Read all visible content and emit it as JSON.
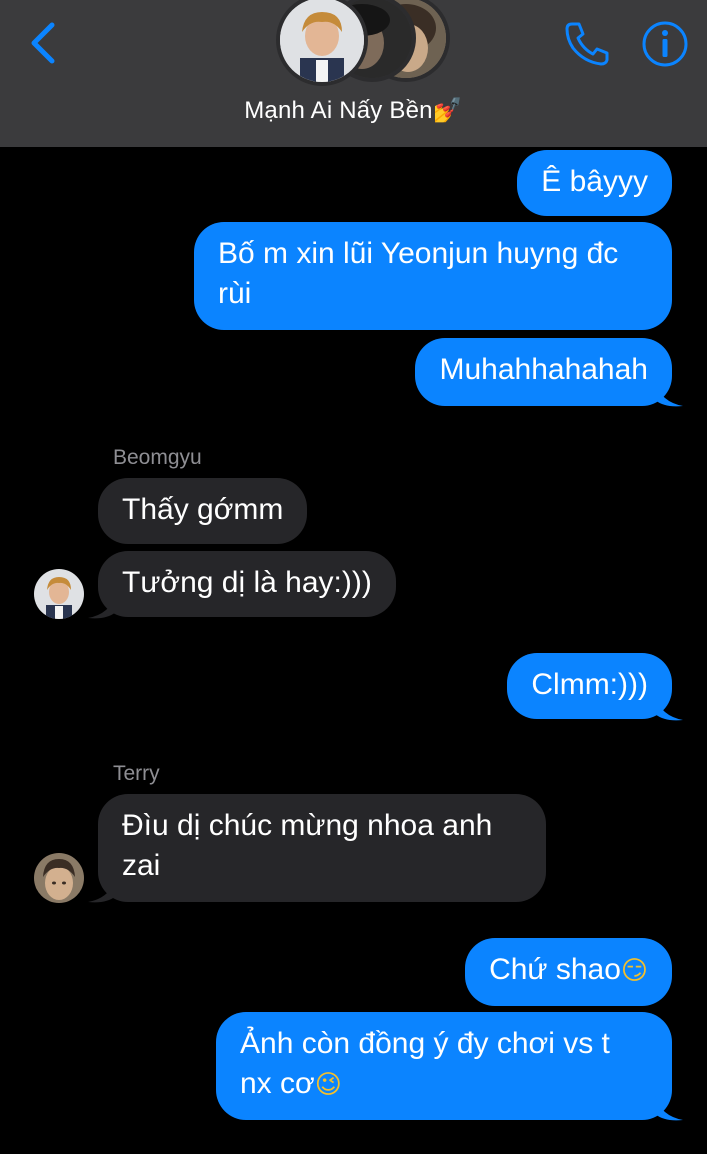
{
  "header": {
    "group_name": "Mạnh Ai Nấy Bền",
    "name_emoji": "💅"
  },
  "colors": {
    "accent": "#0b84ff",
    "incoming_bubble": "#262629",
    "header_bg": "#3b3b3d"
  },
  "messages": [
    {
      "direction": "outgoing",
      "text": "Ê bâyyy"
    },
    {
      "direction": "outgoing",
      "lines": [
        "Bố m xin lũi Yeonjun huyng đc",
        "rùi"
      ]
    },
    {
      "direction": "outgoing",
      "text": "Muhahhahahah"
    },
    {
      "direction": "incoming",
      "sender": "Beomgyu",
      "text": "Thấy gớmm"
    },
    {
      "direction": "incoming",
      "text": "Tưởng dị là hay:)))"
    },
    {
      "direction": "outgoing",
      "text": "Clmm:)))"
    },
    {
      "direction": "incoming",
      "sender": "Terry",
      "lines": [
        "Đìu dị chúc mừng nhoa anh",
        "zai"
      ]
    },
    {
      "direction": "outgoing",
      "text": "Chứ shao",
      "emoji": "😏"
    },
    {
      "direction": "outgoing",
      "lines": [
        "Ảnh còn đồng ý đy chơi vs t",
        "nx cơ"
      ],
      "emoji": "😉"
    }
  ]
}
